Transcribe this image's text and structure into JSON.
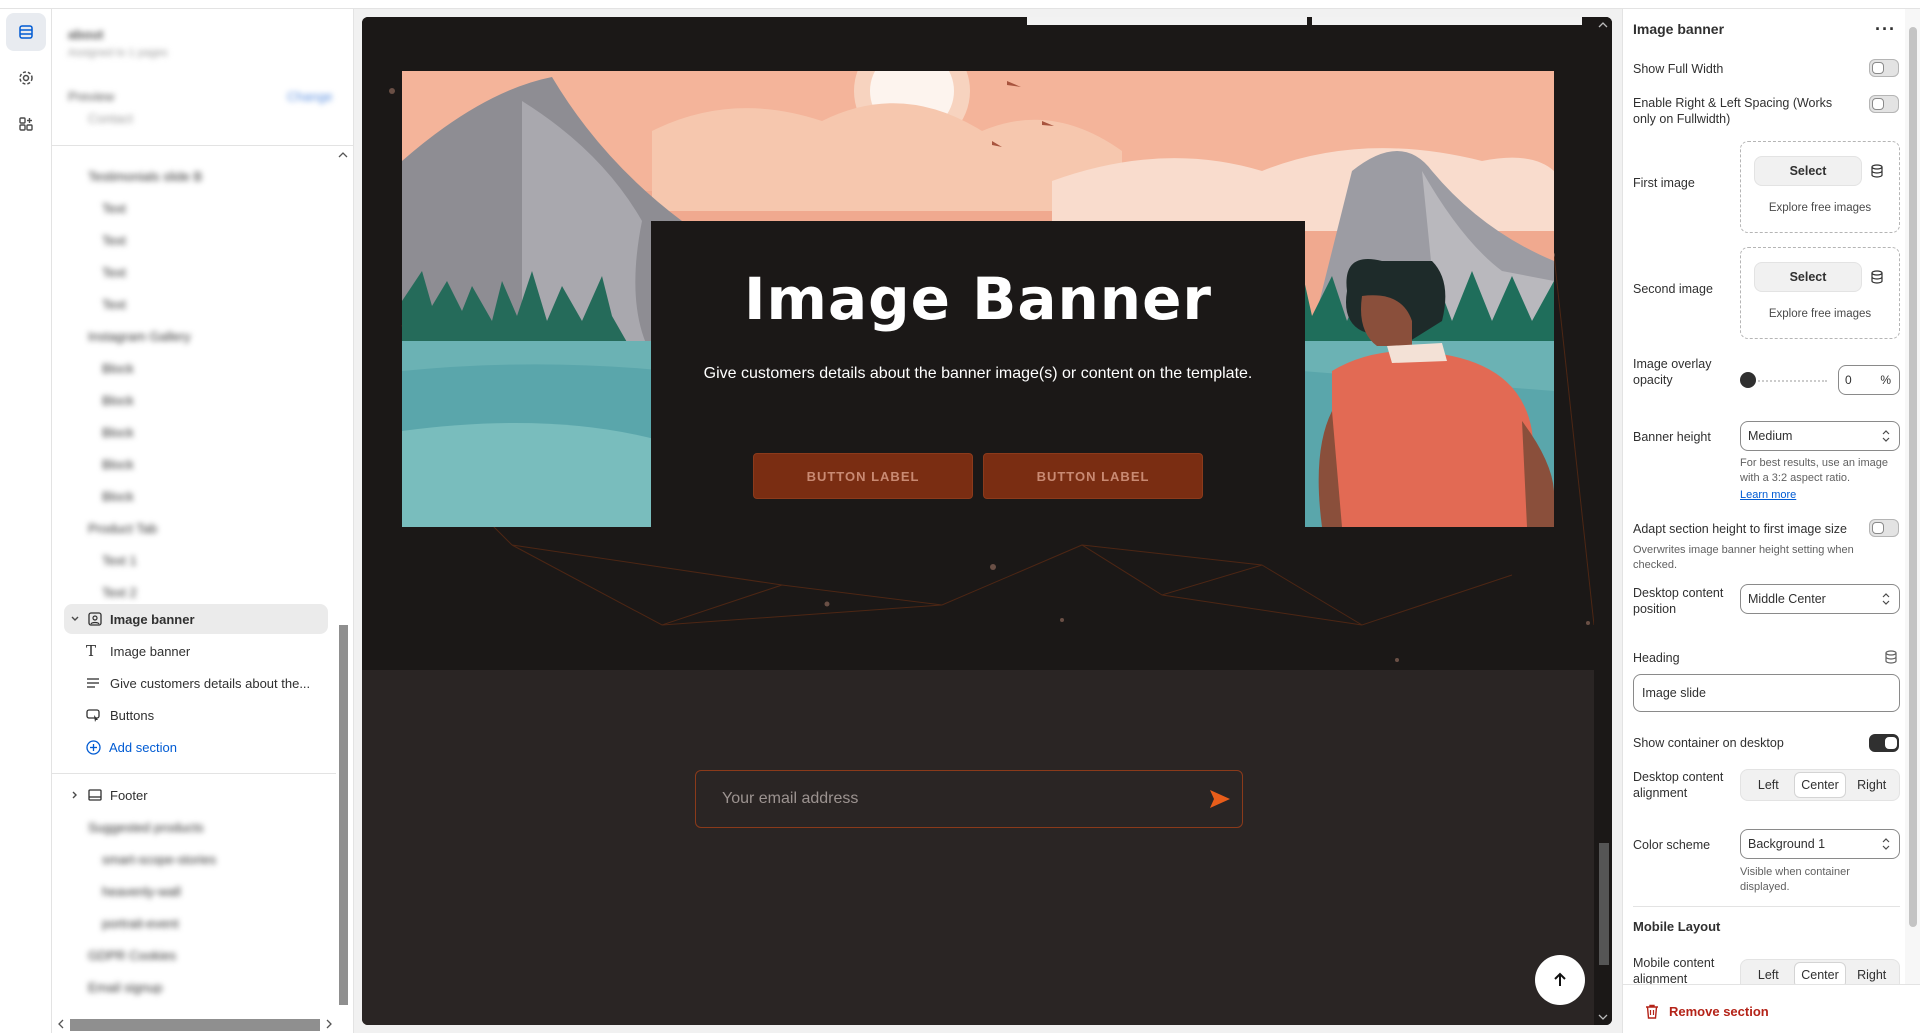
{
  "left_panel": {
    "page_name": "about",
    "page_subtitle": "Assigned to 1 pages",
    "preview_label": "Preview",
    "preview_change": "Change",
    "preview_value": "Contact",
    "blurred_rows": [
      "Testimonials slide B",
      "Text",
      "Text",
      "Text",
      "Text",
      "Instagram Gallery",
      "Block",
      "Block",
      "Block",
      "Block",
      "Block",
      "Product Tab",
      "Text 1",
      "Text 2"
    ],
    "image_banner_section": "Image banner",
    "children": [
      "Image banner",
      "Give customers details about the...",
      "Buttons"
    ],
    "add_section": "Add section",
    "footer": "Footer",
    "blurred_bottom": [
      "Suggested products",
      "smart-scope-stories",
      "heavenly-wall",
      "portrait-event",
      "GDPR Cookies",
      "Email signup"
    ]
  },
  "preview": {
    "title": "Image Banner",
    "subtitle": "Give customers details about the banner image(s) or content on the template.",
    "button1": "BUTTON LABEL",
    "button2": "BUTTON LABEL",
    "email_placeholder": "Your email address"
  },
  "right_panel": {
    "title": "Image banner",
    "show_full_width": "Show Full Width",
    "enable_spacing": "Enable Right & Left Spacing (Works only on Fullwidth)",
    "first_image": "First image",
    "second_image": "Second image",
    "select": "Select",
    "explore": "Explore free images",
    "overlay_opacity": "Image overlay opacity",
    "overlay_value": "0",
    "overlay_unit": "%",
    "banner_height": "Banner height",
    "banner_height_value": "Medium",
    "banner_help": "For best results, use an image with a 3:2 aspect ratio.",
    "learn_more": "Learn more",
    "adapt_height": "Adapt section height to first image size",
    "adapt_help": "Overwrites image banner height setting when checked.",
    "desktop_position": "Desktop content position",
    "desktop_position_value": "Middle Center",
    "heading": "Heading",
    "heading_value": "Image slide",
    "show_container": "Show container on desktop",
    "desktop_alignment": "Desktop content alignment",
    "align_left": "Left",
    "align_center": "Center",
    "align_right": "Right",
    "color_scheme": "Color scheme",
    "color_scheme_value": "Background 1",
    "color_help": "Visible when container displayed.",
    "mobile_layout": "Mobile Layout",
    "mobile_alignment": "Mobile content alignment",
    "remove_section": "Remove section"
  },
  "colors": {
    "accent": "#005bd3",
    "button_brown": "#7a2d12",
    "danger": "#b42318",
    "send_orange": "#e85d1a"
  },
  "icons": [
    "sections-icon",
    "gear-icon",
    "apps-icon",
    "image-icon",
    "text-icon",
    "paragraph-icon",
    "button-icon",
    "plus-circle-icon",
    "footer-icon",
    "chevron-right-icon",
    "chevron-down-icon",
    "database-icon",
    "send-icon",
    "arrow-up-icon",
    "trash-icon",
    "more-icon"
  ]
}
